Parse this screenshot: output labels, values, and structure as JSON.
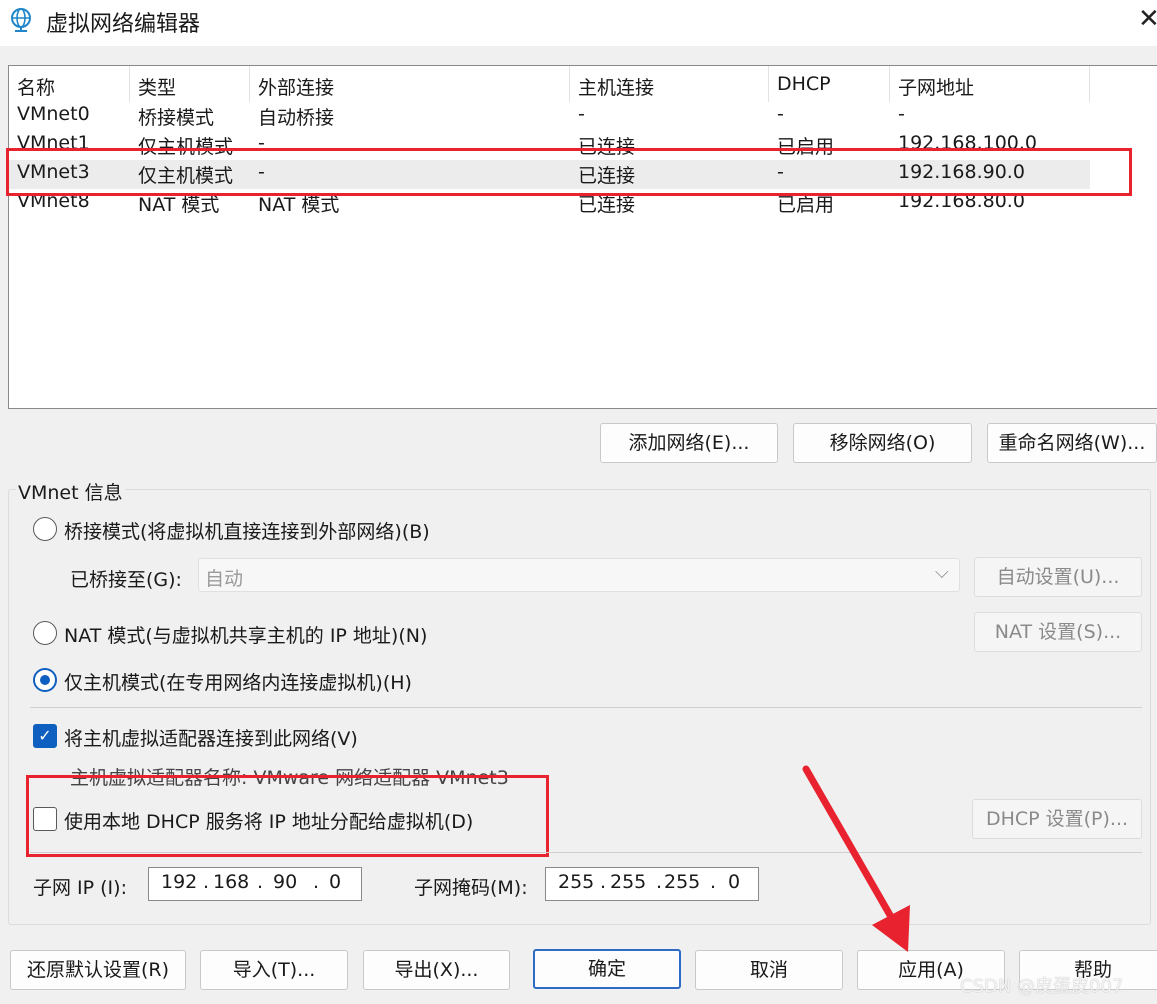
{
  "window": {
    "title": "虚拟网络编辑器",
    "close_glyph": "✕"
  },
  "list": {
    "columns": [
      "名称",
      "类型",
      "外部连接",
      "主机连接",
      "DHCP",
      "子网地址"
    ],
    "rows": [
      [
        "VMnet0",
        "桥接模式",
        "自动桥接",
        "-",
        "-",
        "-"
      ],
      [
        "VMnet1",
        "仅主机模式",
        "-",
        "已连接",
        "已启用",
        "192.168.100.0"
      ],
      [
        "VMnet3",
        "仅主机模式",
        "-",
        "已连接",
        "-",
        "192.168.90.0"
      ],
      [
        "VMnet8",
        "NAT 模式",
        "NAT 模式",
        "已连接",
        "已启用",
        "192.168.80.0"
      ]
    ],
    "selected_row": "VMnet3"
  },
  "list_buttons": {
    "add": "添加网络(E)...",
    "remove": "移除网络(O)",
    "rename": "重命名网络(W)..."
  },
  "info": {
    "group_label": "VMnet 信息",
    "bridged_label": "桥接模式(将虚拟机直接连接到外部网络)(B)",
    "bridged_to_label": "已桥接至(G):",
    "bridged_to_value": "自动",
    "auto_settings": "自动设置(U)...",
    "nat_label": "NAT 模式(与虚拟机共享主机的 IP 地址)(N)",
    "nat_settings": "NAT 设置(S)...",
    "hostonly_label": "仅主机模式(在专用网络内连接虚拟机)(H)",
    "connect_adapter_label": "将主机虚拟适配器连接到此网络(V)",
    "adapter_name_text": "主机虚拟适配器名称: VMware 网络适配器 VMnet3",
    "dhcp_label": "使用本地 DHCP 服务将 IP 地址分配给虚拟机(D)",
    "dhcp_settings": "DHCP 设置(P)...",
    "subnet_ip_label": "子网 IP (I):",
    "subnet_ip": [
      "192",
      "168",
      "90",
      "0"
    ],
    "subnet_mask_label": "子网掩码(M):",
    "subnet_mask": [
      "255",
      "255",
      "255",
      "0"
    ],
    "mode_selected": "host-only",
    "connect_adapter_checked": true,
    "dhcp_checked": false
  },
  "footer_buttons": {
    "restore": "还原默认设置(R)",
    "import": "导入(T)...",
    "export": "导出(X)...",
    "ok": "确定",
    "cancel": "取消",
    "apply": "应用(A)",
    "help": "帮助"
  },
  "watermark": "CSDN @皮蛋皮007",
  "colors": {
    "highlight": "#e8232f",
    "accent": "#0f5fc0"
  }
}
